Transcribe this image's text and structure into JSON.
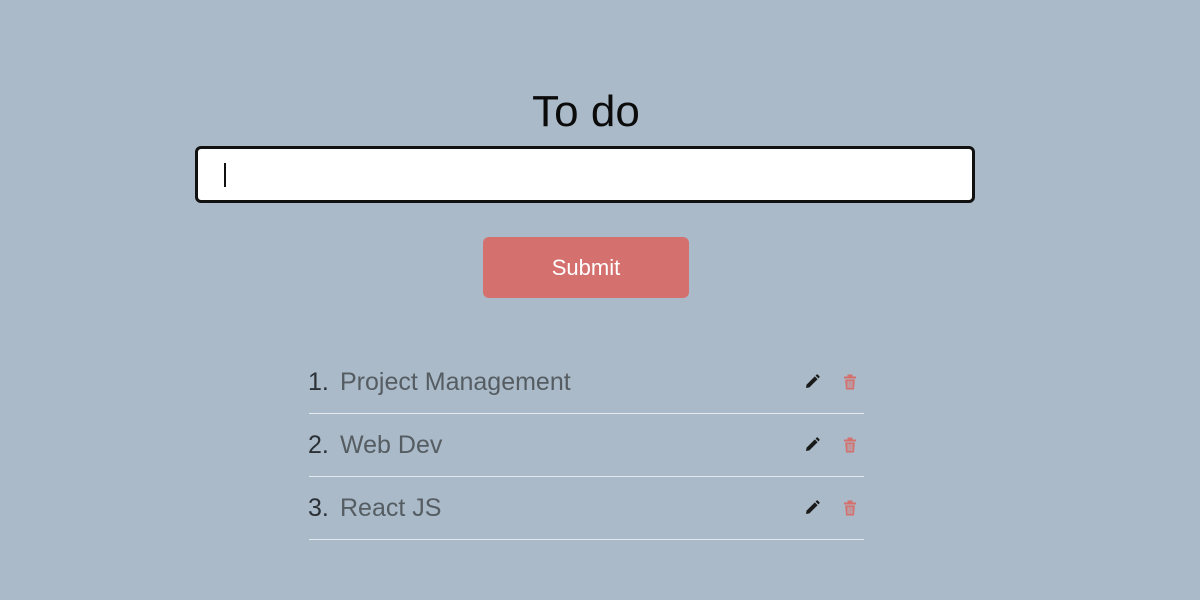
{
  "header": {
    "title": "To do"
  },
  "form": {
    "input_value": "",
    "input_placeholder": "",
    "submit_label": "Submit"
  },
  "todos": [
    {
      "number": "1.",
      "text": "Project Management",
      "edit_icon": "pencil-icon",
      "delete_icon": "trash-icon"
    },
    {
      "number": "2.",
      "text": "Web Dev",
      "edit_icon": "pencil-icon",
      "delete_icon": "trash-icon"
    },
    {
      "number": "3.",
      "text": "React JS",
      "edit_icon": "pencil-icon",
      "delete_icon": "trash-icon"
    }
  ],
  "colors": {
    "background": "#aabac8",
    "submit_button": "#d4706d",
    "delete_icon": "#d4706d",
    "edit_icon": "#1a1a1a"
  }
}
